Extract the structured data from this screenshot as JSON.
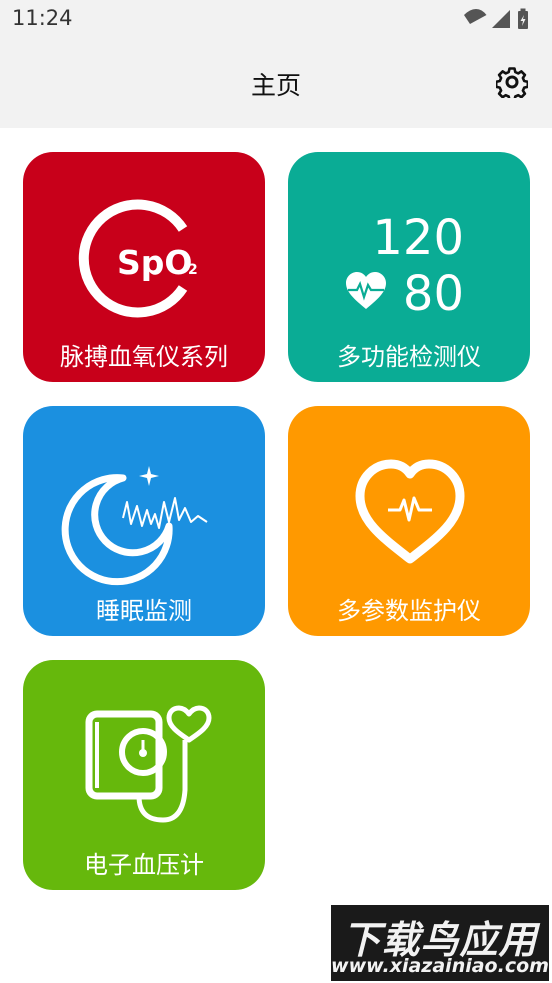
{
  "status_bar": {
    "time": "11:24",
    "icons": [
      "wifi-icon",
      "signal-icon",
      "battery-charging-icon"
    ]
  },
  "header": {
    "title": "主页",
    "settings_icon": "gear-icon"
  },
  "tiles": [
    {
      "label": "脉搏血氧仪系列",
      "color": "#c8001a",
      "icon": "spo2-icon",
      "badge": "SpO",
      "badge_sub": "2"
    },
    {
      "label": "多功能检测仪",
      "color": "#0aac95",
      "icon": "heart-rate-icon",
      "value_top": "120",
      "value_bottom": "80"
    },
    {
      "label": "睡眠监测",
      "color": "#1b90e0",
      "icon": "sleep-moon-icon"
    },
    {
      "label": "多参数监护仪",
      "color": "#ff9900",
      "icon": "heart-pulse-icon"
    },
    {
      "label": "电子血压计",
      "color": "#66b80c",
      "icon": "blood-pressure-cuff-icon"
    }
  ],
  "watermark": {
    "text": "下载鸟应用",
    "url": "www.xiazainiao.com"
  }
}
